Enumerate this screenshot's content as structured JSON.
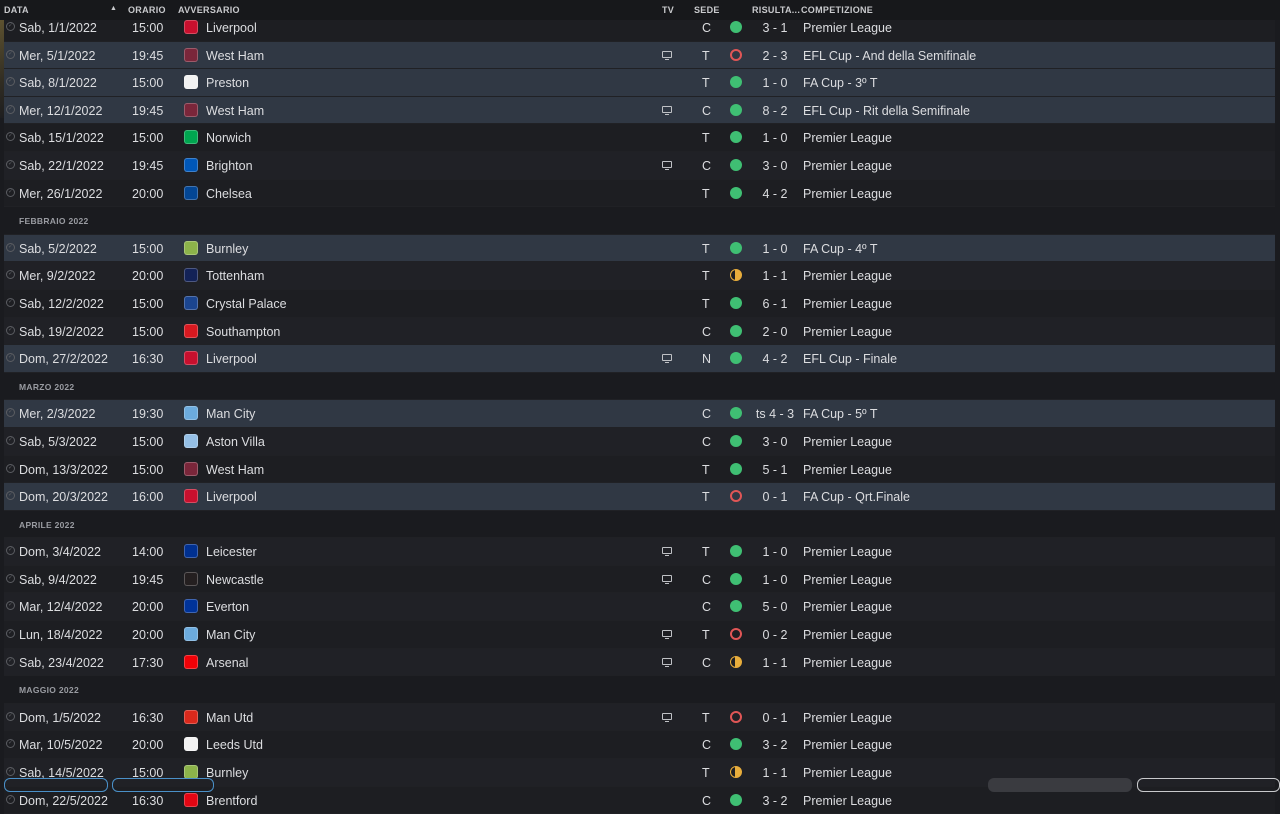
{
  "header": {
    "date": "DATA",
    "time": "ORARIO",
    "opponent": "AVVERSARIO",
    "tv": "TV",
    "venue": "SEDE",
    "result": "RISULTA...",
    "competition": "COMPETIZIONE"
  },
  "colors": {
    "win": "#3fbf73",
    "loss": "#e05656",
    "draw": "#e8ad3c",
    "highlight_row": "#303844"
  },
  "rows": [
    {
      "type": "match",
      "date": "Sab, 1/1/2022",
      "time": "15:00",
      "opp": "Liverpool",
      "crest": "#c8102e",
      "tv": false,
      "venue": "C",
      "res": "w",
      "score": "3 - 1",
      "comp": "Premier League",
      "hl": false
    },
    {
      "type": "match",
      "date": "Mer, 5/1/2022",
      "time": "19:45",
      "opp": "West Ham",
      "crest": "#7a263a",
      "tv": true,
      "venue": "T",
      "res": "l",
      "score": "2 - 3",
      "comp": "EFL Cup - And della Semifinale",
      "hl": true
    },
    {
      "type": "match",
      "date": "Sab, 8/1/2022",
      "time": "15:00",
      "opp": "Preston",
      "crest": "#f2f2f2",
      "tv": false,
      "venue": "T",
      "res": "w",
      "score": "1 - 0",
      "comp": "FA Cup - 3º T",
      "hl": true
    },
    {
      "type": "match",
      "date": "Mer, 12/1/2022",
      "time": "19:45",
      "opp": "West Ham",
      "crest": "#7a263a",
      "tv": true,
      "venue": "C",
      "res": "w",
      "score": "8 - 2",
      "comp": "EFL Cup - Rit della Semifinale",
      "hl": true
    },
    {
      "type": "match",
      "date": "Sab, 15/1/2022",
      "time": "15:00",
      "opp": "Norwich",
      "crest": "#00a650",
      "tv": false,
      "venue": "T",
      "res": "w",
      "score": "1 - 0",
      "comp": "Premier League",
      "hl": false
    },
    {
      "type": "match",
      "date": "Sab, 22/1/2022",
      "time": "19:45",
      "opp": "Brighton",
      "crest": "#0057b8",
      "tv": true,
      "venue": "C",
      "res": "w",
      "score": "3 - 0",
      "comp": "Premier League",
      "hl": false
    },
    {
      "type": "match",
      "date": "Mer, 26/1/2022",
      "time": "20:00",
      "opp": "Chelsea",
      "crest": "#034694",
      "tv": false,
      "venue": "T",
      "res": "w",
      "score": "4 - 2",
      "comp": "Premier League",
      "hl": false
    },
    {
      "type": "month",
      "label": "FEBBRAIO 2022"
    },
    {
      "type": "match",
      "date": "Sab, 5/2/2022",
      "time": "15:00",
      "opp": "Burnley",
      "crest": "#8cb34a",
      "tv": false,
      "venue": "T",
      "res": "w",
      "score": "1 - 0",
      "comp": "FA Cup - 4º T",
      "hl": true
    },
    {
      "type": "match",
      "date": "Mer, 9/2/2022",
      "time": "20:00",
      "opp": "Tottenham",
      "crest": "#132257",
      "tv": false,
      "venue": "T",
      "res": "d",
      "score": "1 - 1",
      "comp": "Premier League",
      "hl": false
    },
    {
      "type": "match",
      "date": "Sab, 12/2/2022",
      "time": "15:00",
      "opp": "Crystal Palace",
      "crest": "#1b458f",
      "tv": false,
      "venue": "T",
      "res": "w",
      "score": "6 - 1",
      "comp": "Premier League",
      "hl": false
    },
    {
      "type": "match",
      "date": "Sab, 19/2/2022",
      "time": "15:00",
      "opp": "Southampton",
      "crest": "#d71920",
      "tv": false,
      "venue": "C",
      "res": "w",
      "score": "2 - 0",
      "comp": "Premier League",
      "hl": false
    },
    {
      "type": "match",
      "date": "Dom, 27/2/2022",
      "time": "16:30",
      "opp": "Liverpool",
      "crest": "#c8102e",
      "tv": true,
      "venue": "N",
      "res": "w",
      "score": "4 - 2",
      "comp": "EFL Cup - Finale",
      "hl": true
    },
    {
      "type": "month",
      "label": "MARZO 2022"
    },
    {
      "type": "match",
      "date": "Mer, 2/3/2022",
      "time": "19:30",
      "opp": "Man City",
      "crest": "#6cabdd",
      "tv": false,
      "venue": "C",
      "res": "w",
      "score": "ts 4 - 3",
      "comp": "FA Cup - 5º T",
      "hl": true
    },
    {
      "type": "match",
      "date": "Sab, 5/3/2022",
      "time": "15:00",
      "opp": "Aston Villa",
      "crest": "#95bfe5",
      "tv": false,
      "venue": "C",
      "res": "w",
      "score": "3 - 0",
      "comp": "Premier League",
      "hl": false
    },
    {
      "type": "match",
      "date": "Dom, 13/3/2022",
      "time": "15:00",
      "opp": "West Ham",
      "crest": "#7a263a",
      "tv": false,
      "venue": "T",
      "res": "w",
      "score": "5 - 1",
      "comp": "Premier League",
      "hl": false
    },
    {
      "type": "match",
      "date": "Dom, 20/3/2022",
      "time": "16:00",
      "opp": "Liverpool",
      "crest": "#c8102e",
      "tv": false,
      "venue": "T",
      "res": "l",
      "score": "0 - 1",
      "comp": "FA Cup - Qrt.Finale",
      "hl": true
    },
    {
      "type": "month",
      "label": "APRILE 2022"
    },
    {
      "type": "match",
      "date": "Dom, 3/4/2022",
      "time": "14:00",
      "opp": "Leicester",
      "crest": "#003090",
      "tv": true,
      "venue": "T",
      "res": "w",
      "score": "1 - 0",
      "comp": "Premier League",
      "hl": false
    },
    {
      "type": "match",
      "date": "Sab, 9/4/2022",
      "time": "19:45",
      "opp": "Newcastle",
      "crest": "#241f20",
      "tv": true,
      "venue": "C",
      "res": "w",
      "score": "1 - 0",
      "comp": "Premier League",
      "hl": false
    },
    {
      "type": "match",
      "date": "Mar, 12/4/2022",
      "time": "20:00",
      "opp": "Everton",
      "crest": "#003399",
      "tv": false,
      "venue": "C",
      "res": "w",
      "score": "5 - 0",
      "comp": "Premier League",
      "hl": false
    },
    {
      "type": "match",
      "date": "Lun, 18/4/2022",
      "time": "20:00",
      "opp": "Man City",
      "crest": "#6cabdd",
      "tv": true,
      "venue": "T",
      "res": "l",
      "score": "0 - 2",
      "comp": "Premier League",
      "hl": false
    },
    {
      "type": "match",
      "date": "Sab, 23/4/2022",
      "time": "17:30",
      "opp": "Arsenal",
      "crest": "#ef0107",
      "tv": true,
      "venue": "C",
      "res": "d",
      "score": "1 - 1",
      "comp": "Premier League",
      "hl": false
    },
    {
      "type": "month",
      "label": "MAGGIO 2022"
    },
    {
      "type": "match",
      "date": "Dom, 1/5/2022",
      "time": "16:30",
      "opp": "Man Utd",
      "crest": "#da291c",
      "tv": true,
      "venue": "T",
      "res": "l",
      "score": "0 - 1",
      "comp": "Premier League",
      "hl": false
    },
    {
      "type": "match",
      "date": "Mar, 10/5/2022",
      "time": "20:00",
      "opp": "Leeds Utd",
      "crest": "#f2f2f2",
      "tv": false,
      "venue": "C",
      "res": "w",
      "score": "3 - 2",
      "comp": "Premier League",
      "hl": false
    },
    {
      "type": "match",
      "date": "Sab, 14/5/2022",
      "time": "15:00",
      "opp": "Burnley",
      "crest": "#8cb34a",
      "tv": false,
      "venue": "T",
      "res": "d",
      "score": "1 - 1",
      "comp": "Premier League",
      "hl": false
    },
    {
      "type": "match",
      "date": "Dom, 22/5/2022",
      "time": "16:30",
      "opp": "Brentford",
      "crest": "#e30613",
      "tv": false,
      "venue": "C",
      "res": "w",
      "score": "3 - 2",
      "comp": "Premier League",
      "hl": false
    }
  ]
}
